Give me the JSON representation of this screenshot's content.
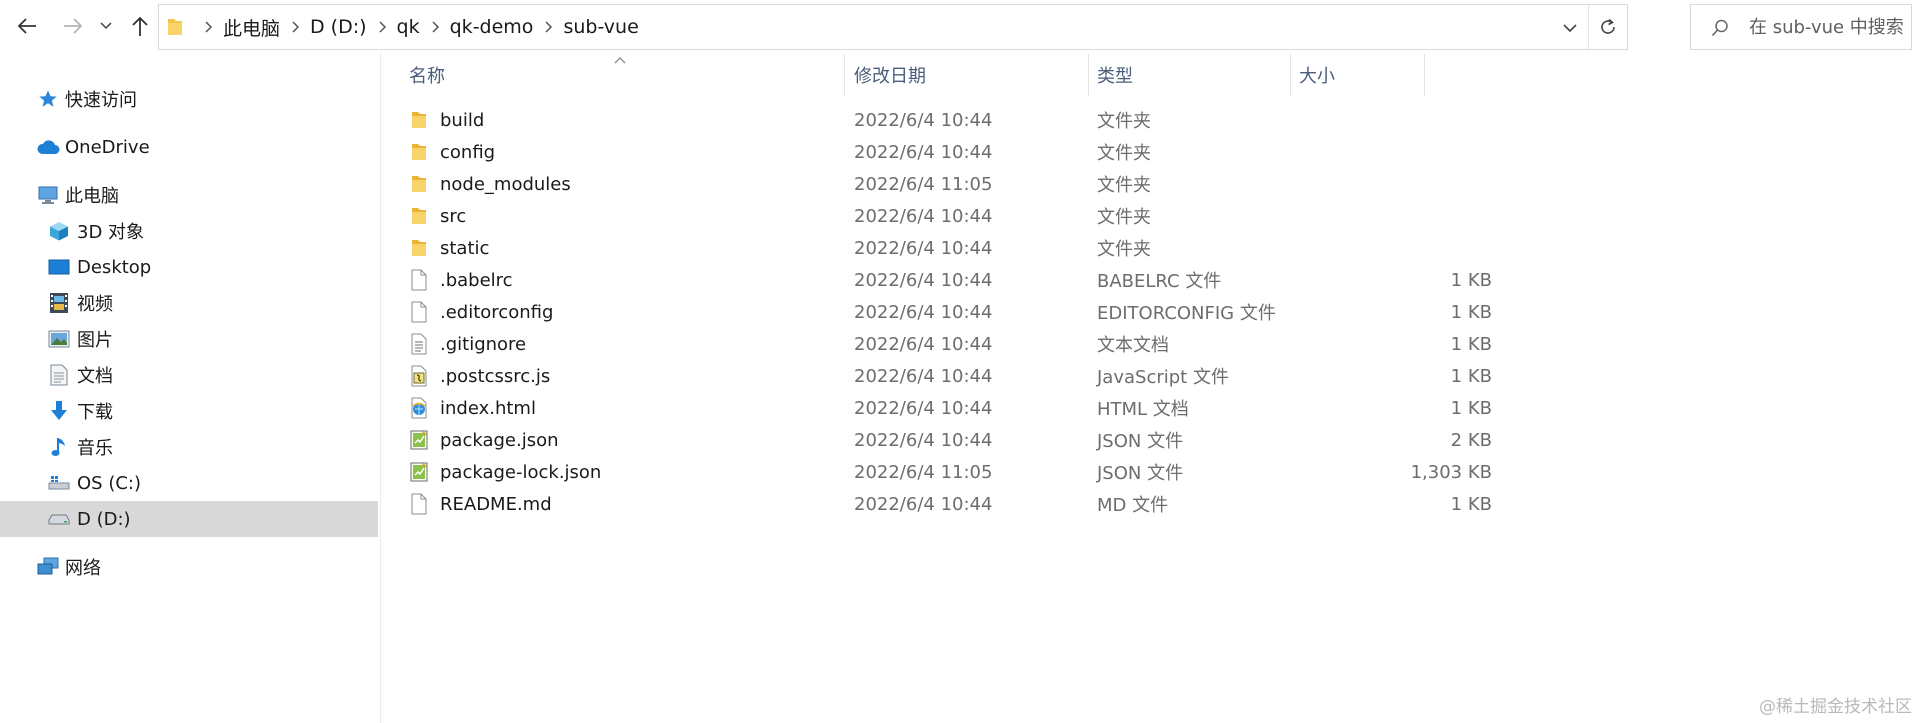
{
  "address_bar": {
    "breadcrumbs": [
      "此电脑",
      "D (D:)",
      "qk",
      "qk-demo",
      "sub-vue"
    ]
  },
  "search": {
    "placeholder": "在 sub-vue 中搜索"
  },
  "sidebar": {
    "items": [
      {
        "label": "快速访问",
        "icon": "star-icon",
        "level": "top"
      },
      {
        "label": "OneDrive",
        "icon": "cloud-icon",
        "level": "top"
      },
      {
        "label": "此电脑",
        "icon": "computer-icon",
        "level": "top"
      },
      {
        "label": "3D 对象",
        "icon": "cube-3d-icon",
        "level": "sub"
      },
      {
        "label": "Desktop",
        "icon": "desktop-icon",
        "level": "sub"
      },
      {
        "label": "视频",
        "icon": "video-icon",
        "level": "sub"
      },
      {
        "label": "图片",
        "icon": "pictures-icon",
        "level": "sub"
      },
      {
        "label": "文档",
        "icon": "documents-icon",
        "level": "sub"
      },
      {
        "label": "下载",
        "icon": "download-icon",
        "level": "sub"
      },
      {
        "label": "音乐",
        "icon": "music-icon",
        "level": "sub"
      },
      {
        "label": "OS (C:)",
        "icon": "windows-drive-icon",
        "level": "sub"
      },
      {
        "label": "D (D:)",
        "icon": "drive-icon",
        "level": "sub",
        "selected": true
      },
      {
        "label": "网络",
        "icon": "network-icon",
        "level": "top"
      }
    ]
  },
  "columns": {
    "name": "名称",
    "date": "修改日期",
    "type": "类型",
    "size": "大小"
  },
  "files": [
    {
      "name": "build",
      "date": "2022/6/4 10:44",
      "type": "文件夹",
      "size": "",
      "icon": "folder-icon"
    },
    {
      "name": "config",
      "date": "2022/6/4 10:44",
      "type": "文件夹",
      "size": "",
      "icon": "folder-icon"
    },
    {
      "name": "node_modules",
      "date": "2022/6/4 11:05",
      "type": "文件夹",
      "size": "",
      "icon": "folder-icon"
    },
    {
      "name": "src",
      "date": "2022/6/4 10:44",
      "type": "文件夹",
      "size": "",
      "icon": "folder-icon"
    },
    {
      "name": "static",
      "date": "2022/6/4 10:44",
      "type": "文件夹",
      "size": "",
      "icon": "folder-icon"
    },
    {
      "name": ".babelrc",
      "date": "2022/6/4 10:44",
      "type": "BABELRC 文件",
      "size": "1 KB",
      "icon": "blank-file-icon"
    },
    {
      "name": ".editorconfig",
      "date": "2022/6/4 10:44",
      "type": "EDITORCONFIG 文件",
      "size": "1 KB",
      "icon": "blank-file-icon"
    },
    {
      "name": ".gitignore",
      "date": "2022/6/4 10:44",
      "type": "文本文档",
      "size": "1 KB",
      "icon": "text-file-icon"
    },
    {
      "name": ".postcssrc.js",
      "date": "2022/6/4 10:44",
      "type": "JavaScript 文件",
      "size": "1 KB",
      "icon": "script-file-icon"
    },
    {
      "name": "index.html",
      "date": "2022/6/4 10:44",
      "type": "HTML 文档",
      "size": "1 KB",
      "icon": "html-file-icon"
    },
    {
      "name": "package.json",
      "date": "2022/6/4 10:44",
      "type": "JSON 文件",
      "size": "2 KB",
      "icon": "json-file-icon"
    },
    {
      "name": "package-lock.json",
      "date": "2022/6/4 11:05",
      "type": "JSON 文件",
      "size": "1,303 KB",
      "icon": "json-file-icon"
    },
    {
      "name": "README.md",
      "date": "2022/6/4 10:44",
      "type": "MD 文件",
      "size": "1 KB",
      "icon": "blank-file-icon"
    }
  ],
  "watermark": "@稀土掘金技术社区",
  "colors": {
    "selected_bg": "#d9d9d9",
    "folder": "#f3c54b",
    "header_text": "#4a5d7a",
    "accent": "#1e7fd6"
  }
}
